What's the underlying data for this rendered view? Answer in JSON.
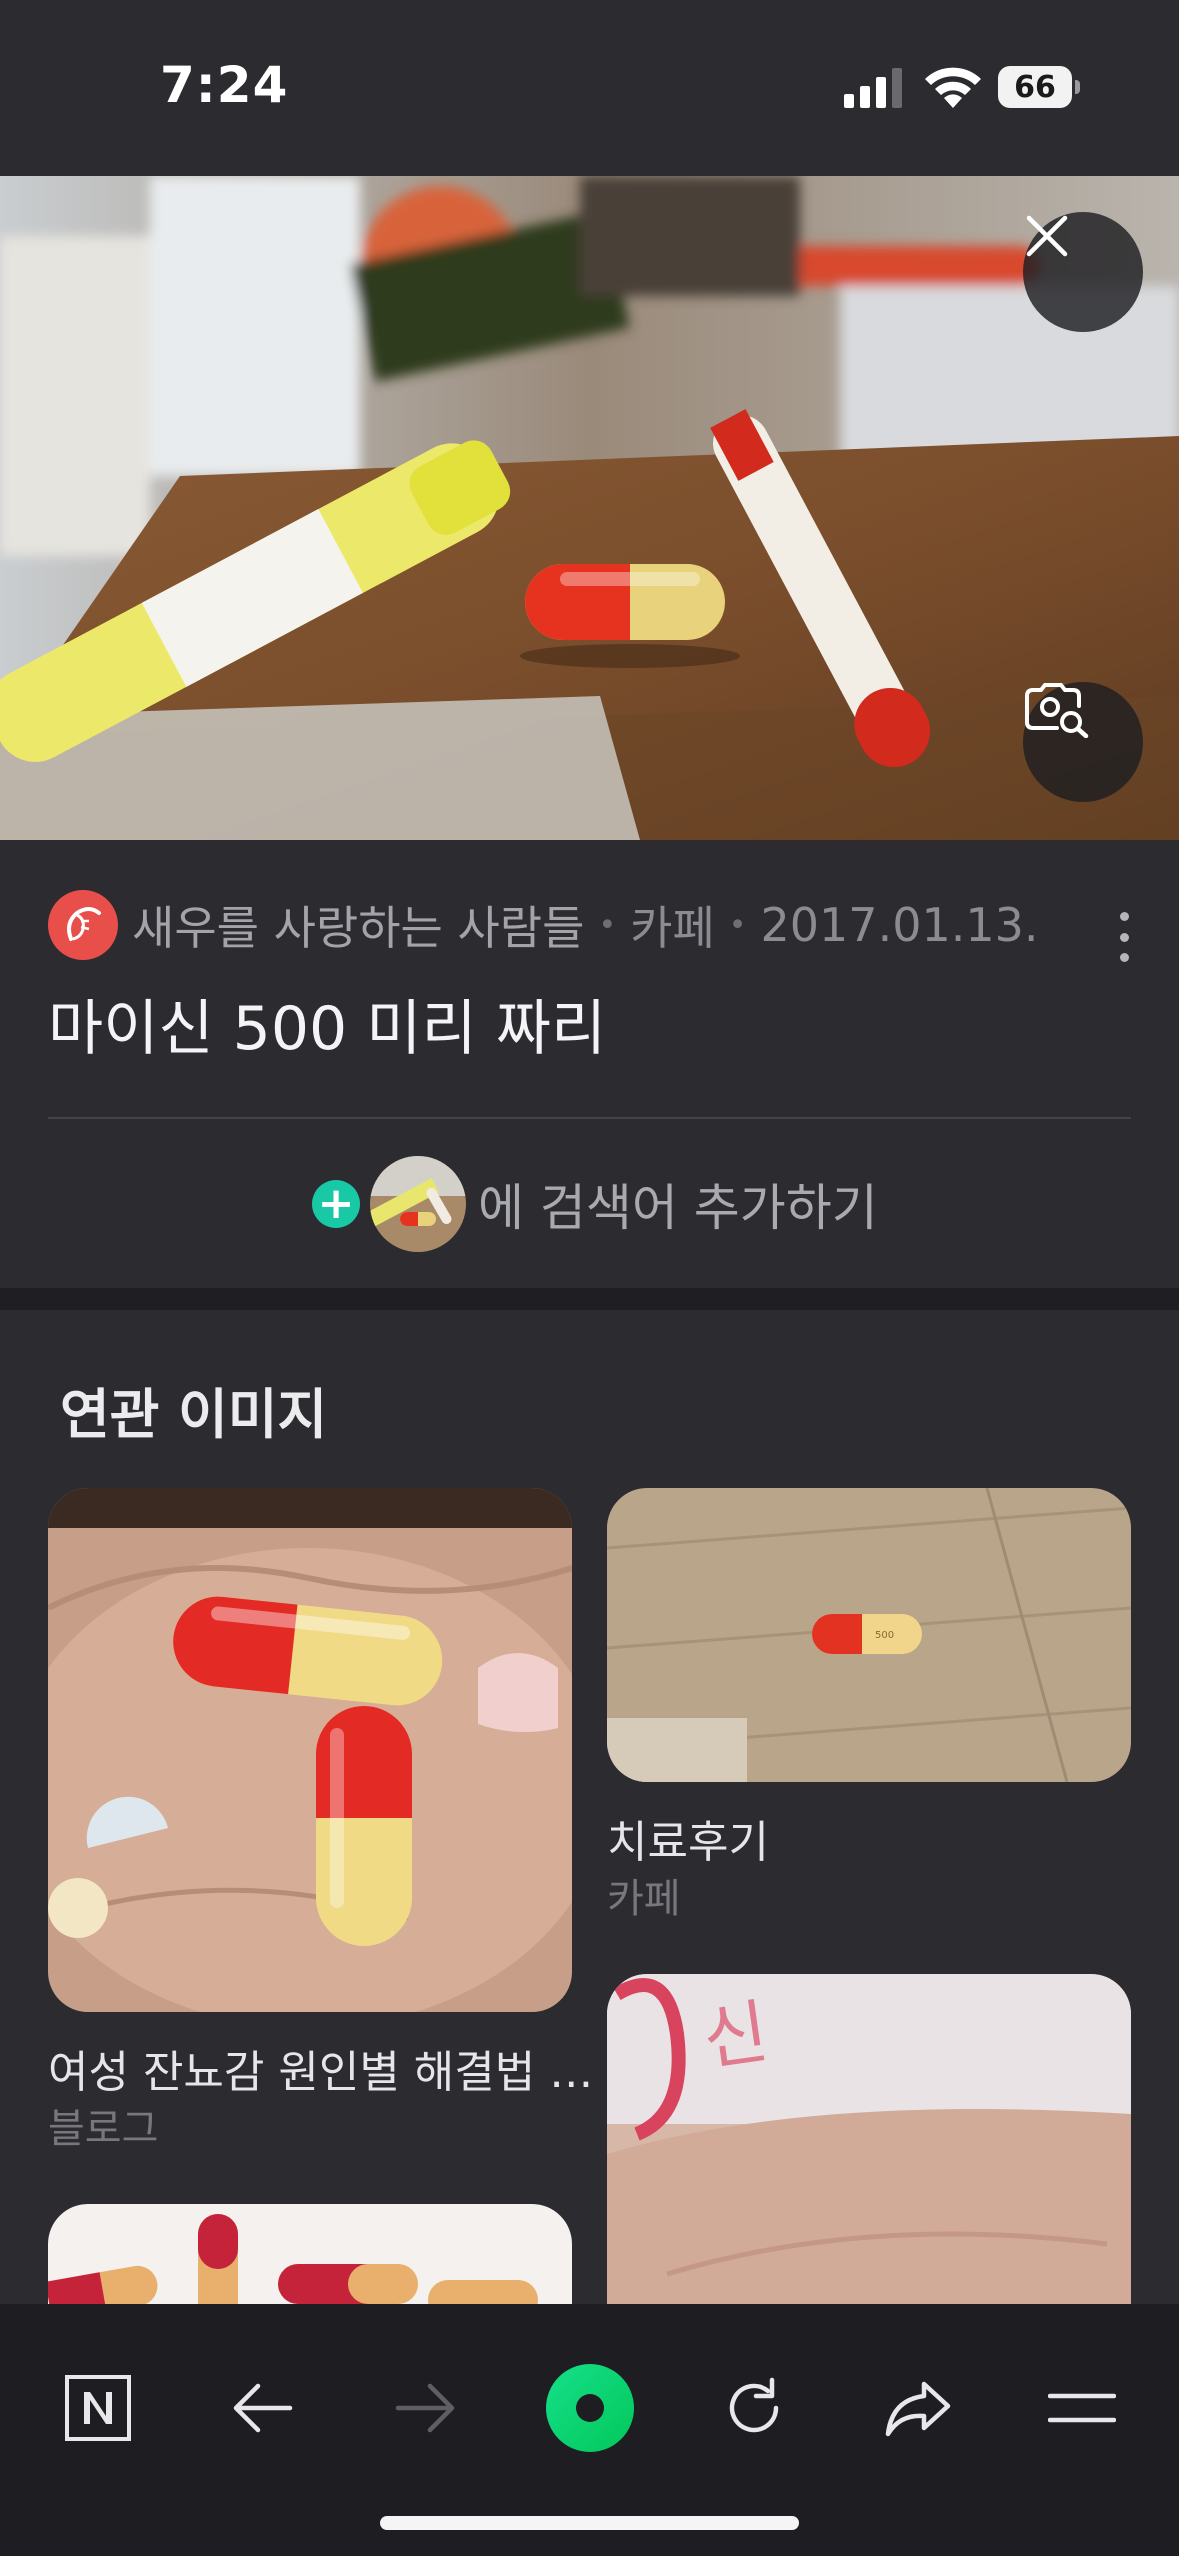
{
  "status_bar": {
    "time": "7:24",
    "battery": "66"
  },
  "post": {
    "source_name": "새우를 사랑하는 사람들",
    "source_type": "카페",
    "date": "2017.01.13.",
    "title": "마이신 500 미리 짜리",
    "add_search_text": "에 검색어 추가하기"
  },
  "related": {
    "title": "연관 이미지",
    "items": [
      {
        "caption": "여성 잔뇨감 원인별 해결법 …",
        "source": "블로그"
      },
      {
        "caption": "치료후기",
        "source": "카페"
      },
      {
        "caption": "",
        "source": ""
      },
      {
        "caption": "",
        "source": ""
      }
    ]
  },
  "icons": {
    "close": "close-icon",
    "lens": "image-search-icon",
    "more": "more-vertical-icon",
    "naver": "naver-n-icon",
    "back": "arrow-left-icon",
    "forward": "arrow-right-icon",
    "green_dot": "green-circle-icon",
    "refresh": "refresh-icon",
    "share": "share-icon",
    "menu": "menu-icon"
  },
  "colors": {
    "background": "#2b2b30",
    "toolbar": "#1e1e22",
    "accent_green": "#03c75a",
    "plus_teal": "#19c9a5",
    "avatar_red": "#e84e4a"
  }
}
